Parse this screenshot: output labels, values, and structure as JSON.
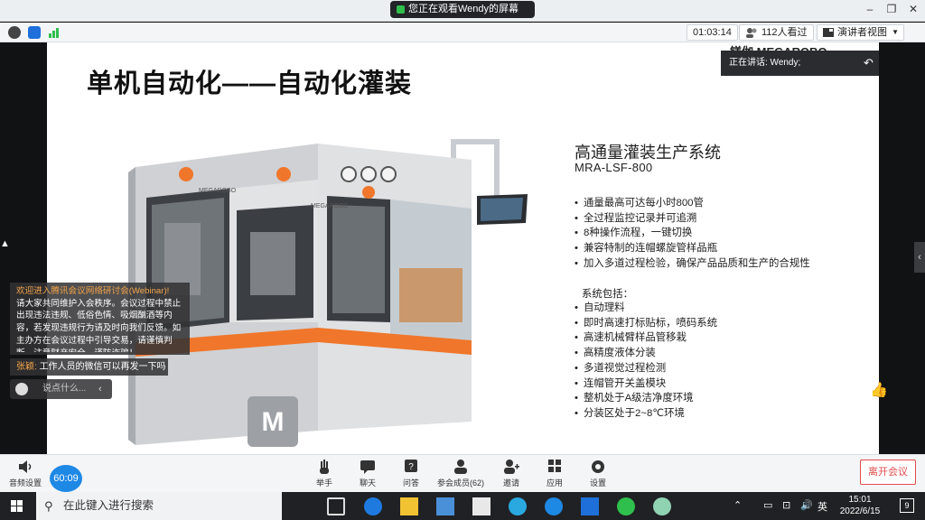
{
  "window": {
    "share_status": "您正在观看Wendy的屏幕"
  },
  "toolbar": {
    "elapsed": "01:03:14",
    "attendees": "112人看过",
    "view_mode": "演讲者视图"
  },
  "speaker": {
    "label": "正在讲话: Wendy;"
  },
  "slide": {
    "title": "单机自动化——自动化灌装",
    "logo": "镁伽 MEGAROBO",
    "product_title": "高通量灌装生产系统",
    "product_model": "MRA-LSF-800",
    "features": [
      "通量最高可达每小时800管",
      "全过程监控记录并可追溯",
      "8种操作流程，一键切换",
      "兼容特制的连帽螺旋管样品瓶",
      "加入多道过程检验，确保产品品质和生产的合规性"
    ],
    "system_label": "系统包括：",
    "system_items": [
      "自动理料",
      "即时高速打标贴标，喷码系统",
      "高速机械臂样品管移栽",
      "高精度液体分装",
      "多道视觉过程检测",
      "连帽管开关盖模块",
      "整机处于A级洁净度环境",
      "分装区处于2~8℃环境"
    ],
    "machine_brand": "MEGAROBO"
  },
  "chat": {
    "welcome_header": "欢迎进入腾讯会议网络研讨会(Webinar)!",
    "welcome_body": "请大家共同维护入会秩序。会议过程中禁止出现违法违规、低俗色情、吸烟酗酒等内容，若发现违规行为请及时向我们反馈。如主办方在会议过程中引导交易，请谨慎判断，注意财产安全，谨防诈骗！",
    "message_name": "张颖:",
    "message_text": "工作人员的微信可以再发一下吗",
    "input_placeholder": "说点什么..."
  },
  "bottombar": {
    "audio_label": "音频设置",
    "timer": "60:09",
    "buttons": [
      "举手",
      "聊天",
      "问答",
      "参会成员(62)",
      "邀请",
      "应用",
      "设置"
    ],
    "leave_label": "离开会议"
  },
  "taskbar": {
    "search_placeholder": "在此键入进行搜索",
    "ime": "英",
    "time": "15:01",
    "date": "2022/6/15",
    "notifications": "9"
  },
  "colors": {
    "accent_orange": "#f0762b",
    "leave_red": "#e14b4b",
    "timer_blue": "#1e88e5"
  }
}
